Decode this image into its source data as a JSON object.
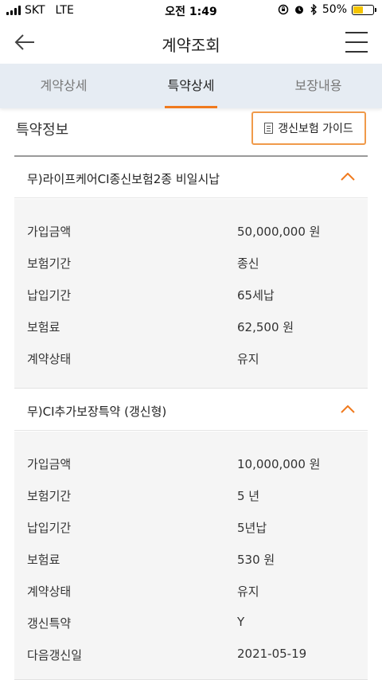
{
  "status": {
    "carrier": "SKT",
    "network": "LTE",
    "time": "오전 1:49",
    "battery_text": "50%",
    "battery_level": 0.5
  },
  "header": {
    "title": "계약조회",
    "back_icon": "arrow-left-icon",
    "menu_icon": "hamburger-menu-icon"
  },
  "tabs": [
    {
      "label": "계약상세",
      "active": false
    },
    {
      "label": "특약상세",
      "active": true
    },
    {
      "label": "보장내용",
      "active": false
    }
  ],
  "section": {
    "title": "특약정보",
    "guide_label": "갱신보험 가이드",
    "guide_icon": "document-icon"
  },
  "riders": [
    {
      "name": "무)라이프케어CI종신보험2종 비일시납",
      "expanded": true,
      "rows": [
        {
          "label": "가입금액",
          "value": "50,000,000 원"
        },
        {
          "label": "보험기간",
          "value": "종신"
        },
        {
          "label": "납입기간",
          "value": "65세납"
        },
        {
          "label": "보험료",
          "value": "62,500 원"
        },
        {
          "label": "계약상태",
          "value": "유지"
        }
      ]
    },
    {
      "name": "무)CI추가보장특약 (갱신형)",
      "expanded": true,
      "rows": [
        {
          "label": "가입금액",
          "value": "10,000,000 원"
        },
        {
          "label": "보험기간",
          "value": "5 년"
        },
        {
          "label": "납입기간",
          "value": "5년납"
        },
        {
          "label": "보험료",
          "value": "530 원"
        },
        {
          "label": "계약상태",
          "value": "유지"
        },
        {
          "label": "갱신특약",
          "value": "Y"
        },
        {
          "label": "다음갱신일",
          "value": "2021-05-19"
        }
      ]
    }
  ],
  "colors": {
    "accent": "#f07a1e",
    "tab_bg": "#e6ecf3",
    "detail_bg": "#f5f5f5"
  }
}
